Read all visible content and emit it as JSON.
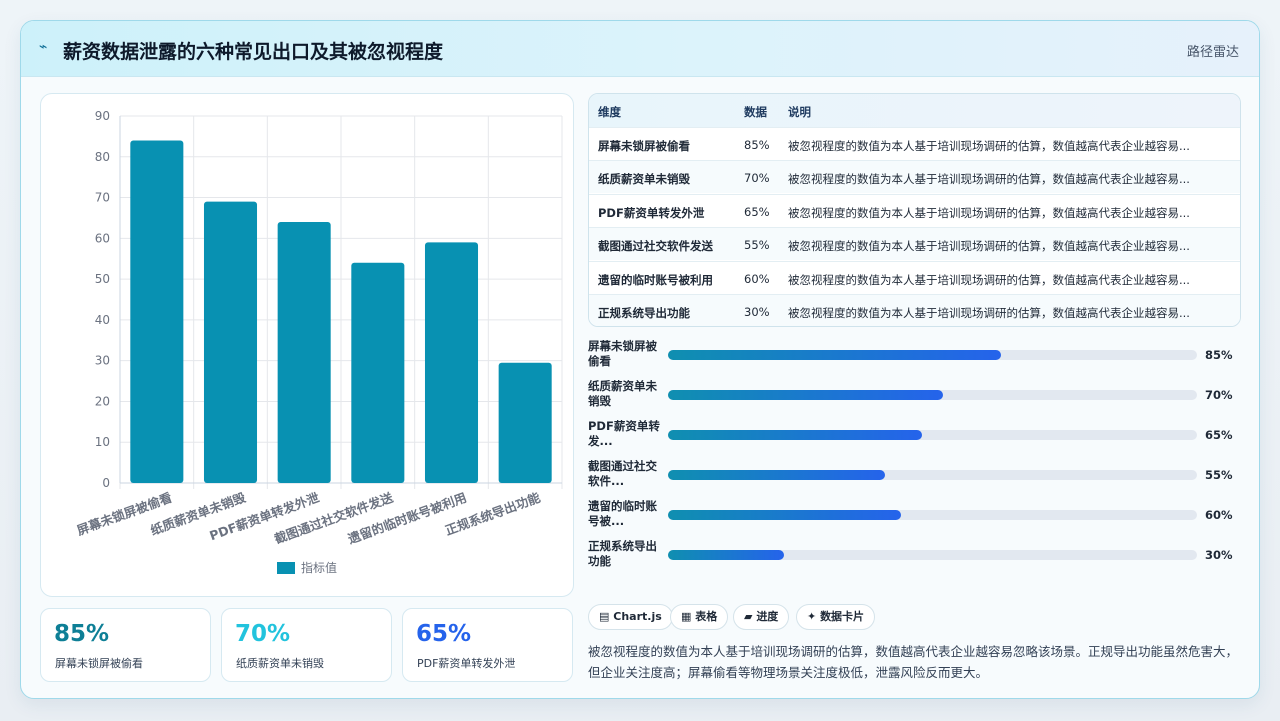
{
  "header": {
    "logo_icon": "⌁",
    "title": "薪资数据泄露的六种常见出口及其被忽视程度",
    "brand": "路径雷达"
  },
  "chart_data": {
    "type": "bar",
    "categories": [
      "屏幕未锁屏被偷看",
      "纸质薪资单未销毁",
      "PDF薪资单转发外泄",
      "截图通过社交软件发送",
      "遗留的临时账号被利用",
      "正规系统导出功能"
    ],
    "values": [
      84,
      69,
      64,
      54,
      59,
      29.5
    ],
    "legend": "指标值",
    "ylim": [
      0,
      90
    ],
    "yticks": [
      0,
      10,
      20,
      30,
      40,
      50,
      60,
      70,
      80,
      90
    ],
    "bar_color": "#0891b2",
    "grid": true,
    "legend_position": "bottom"
  },
  "stats": [
    {
      "value": "85%",
      "label": "屏幕未锁屏被偷看",
      "color": "#0e7f96"
    },
    {
      "value": "70%",
      "label": "纸质薪资单未销毁",
      "color": "#22c3dd"
    },
    {
      "value": "65%",
      "label": "PDF薪资单转发外泄",
      "color": "#2563eb"
    }
  ],
  "table": {
    "headers": [
      "维度",
      "数据",
      "说明"
    ],
    "rows": [
      {
        "dim": "屏幕未锁屏被偷看",
        "val": "85%",
        "desc": "被忽视程度的数值为本人基于培训现场调研的估算，数值越高代表企业越容易..."
      },
      {
        "dim": "纸质薪资单未销毁",
        "val": "70%",
        "desc": "被忽视程度的数值为本人基于培训现场调研的估算，数值越高代表企业越容易..."
      },
      {
        "dim": "PDF薪资单转发外泄",
        "val": "65%",
        "desc": "被忽视程度的数值为本人基于培训现场调研的估算，数值越高代表企业越容易..."
      },
      {
        "dim": "截图通过社交软件发送",
        "val": "55%",
        "desc": "被忽视程度的数值为本人基于培训现场调研的估算，数值越高代表企业越容易..."
      },
      {
        "dim": "遗留的临时账号被利用",
        "val": "60%",
        "desc": "被忽视程度的数值为本人基于培训现场调研的估算，数值越高代表企业越容易..."
      },
      {
        "dim": "正规系统导出功能",
        "val": "30%",
        "desc": "被忽视程度的数值为本人基于培训现场调研的估算，数值越高代表企业越容易..."
      }
    ]
  },
  "progress": [
    {
      "line1": "屏幕未锁屏被",
      "line2": "偷看",
      "value": "85%",
      "level": 63
    },
    {
      "line1": "纸质薪资单未",
      "line2": "销毁",
      "value": "70%",
      "level": 52
    },
    {
      "line1": "PDF薪资单转",
      "line2": "发...",
      "value": "65%",
      "level": 48
    },
    {
      "line1": "截图通过社交",
      "line2": "软件...",
      "value": "55%",
      "level": 41
    },
    {
      "line1": "遗留的临时账",
      "line2": "号被...",
      "value": "60%",
      "level": 44
    },
    {
      "line1": "正规系统导出",
      "line2": "功能",
      "value": "30%",
      "level": 22
    }
  ],
  "chips": [
    {
      "icon": "▤",
      "label": "Chart.js"
    },
    {
      "icon": "▦",
      "label": "表格"
    },
    {
      "icon": "▰",
      "label": "进度"
    },
    {
      "icon": "✦",
      "label": "数据卡片"
    }
  ],
  "note": "被忽视程度的数值为本人基于培训现场调研的估算，数值越高代表企业越容易忽略该场景。正规导出功能虽然危害大，但企业关注度高；屏幕偷看等物理场景关注度极低，泄露风险反而更大。"
}
